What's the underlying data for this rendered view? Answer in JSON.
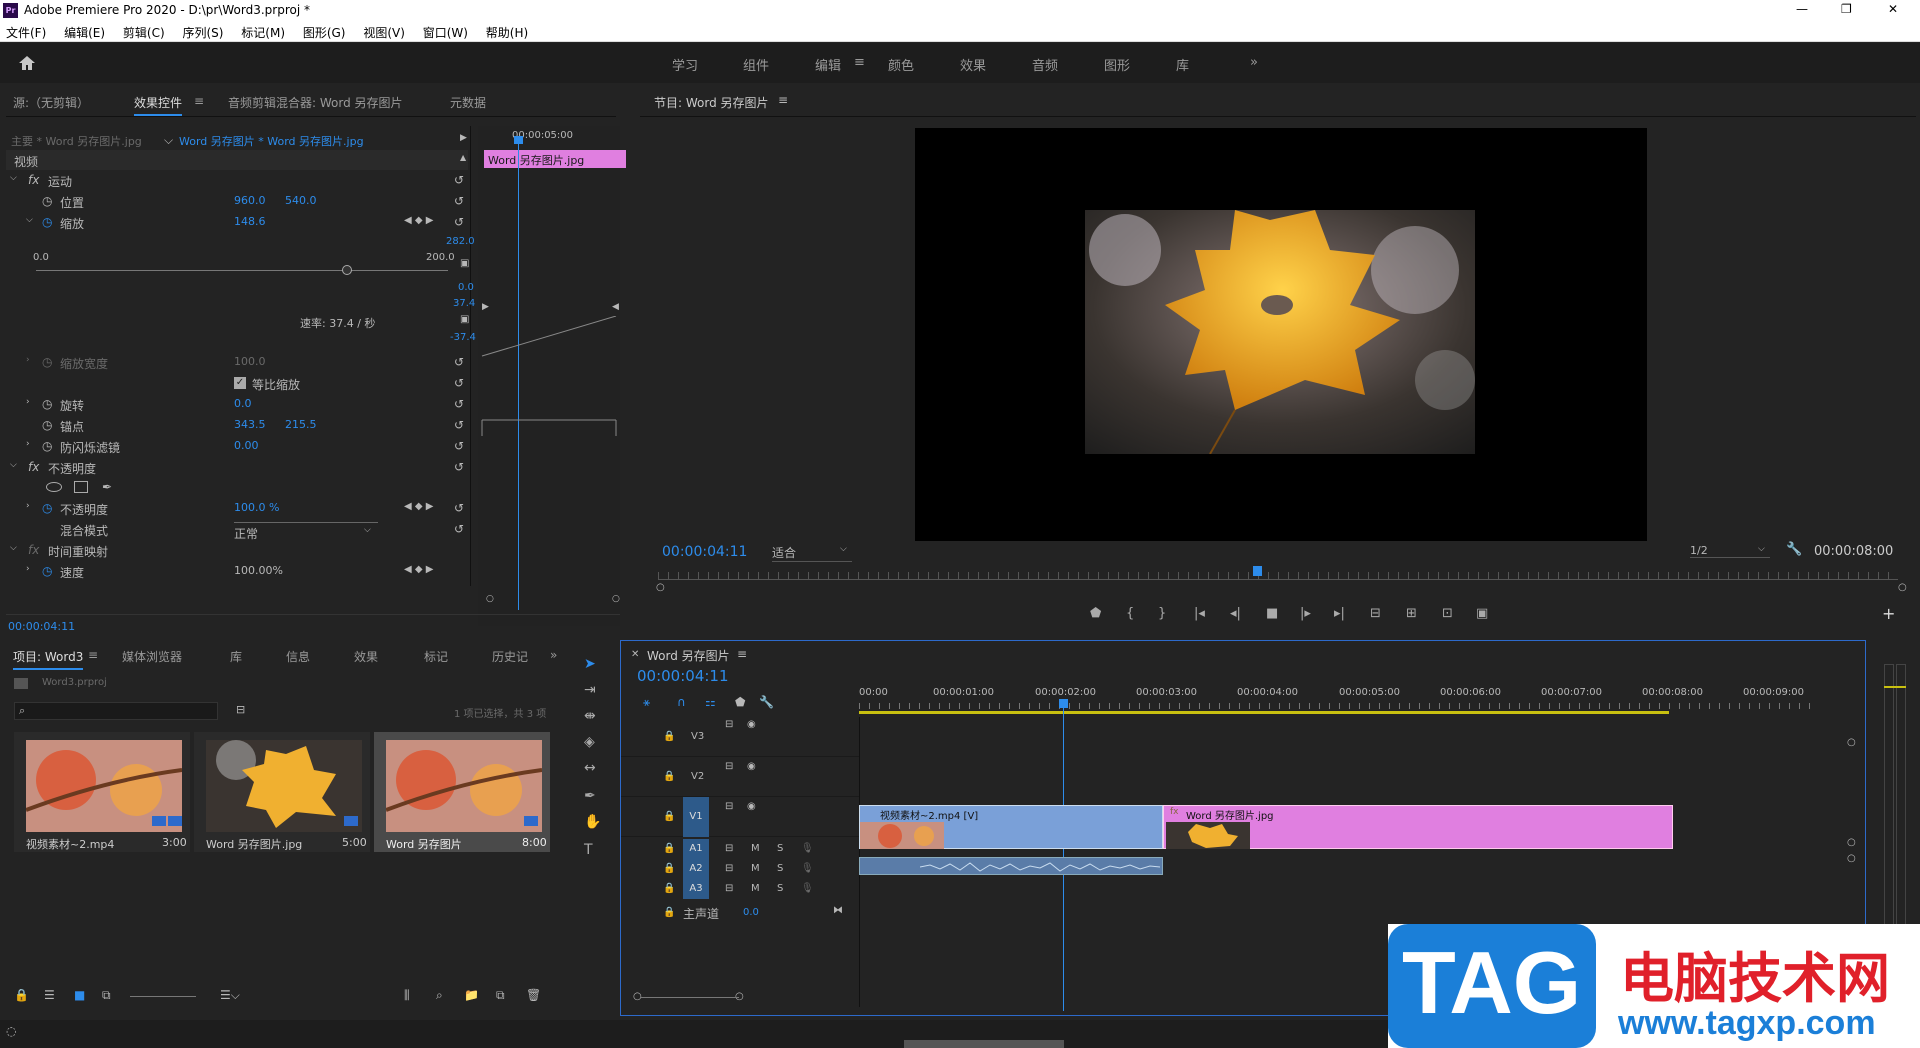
{
  "app": {
    "title": "Adobe Premiere Pro 2020 - D:\\pr\\Word3.prproj *",
    "icon": "Pr"
  },
  "window_controls": {
    "minimize": "—",
    "restore": "❐",
    "close": "✕"
  },
  "menu": [
    "文件(F)",
    "编辑(E)",
    "剪辑(C)",
    "序列(S)",
    "标记(M)",
    "图形(G)",
    "视图(V)",
    "窗口(W)",
    "帮助(H)"
  ],
  "workspaces": [
    "学习",
    "组件",
    "编辑",
    "颜色",
    "效果",
    "音频",
    "图形",
    "库"
  ],
  "workspace_active": "编辑",
  "source_panel": {
    "tabs": [
      "源:（无剪辑）",
      "效果控件",
      "音频剪辑混合器: Word 另存图片",
      "元数据"
    ],
    "active": "效果控件",
    "master": "主要 * Word 另存图片.jpg",
    "clip": "Word 另存图片 * Word 另存图片.jpg",
    "timecode_ruler": "00:00:05:00",
    "clip_bar": "Word 另存图片.jpg",
    "section_video": "视频",
    "motion": "运动",
    "position_label": "位置",
    "position_x": "960.0",
    "position_y": "540.0",
    "scale_label": "缩放",
    "scale_value": "148.6",
    "slider_min": "0.0",
    "slider_max": "200.0",
    "graph_top": "282.0",
    "graph_zero": "0.0",
    "vel_top": "37.4",
    "vel_label": "速率: 37.4 / 秒",
    "vel_bottom": "-37.4",
    "scale_width_label": "缩放宽度",
    "scale_width_value": "100.0",
    "uniform_scale": "等比缩放",
    "rotation_label": "旋转",
    "rotation_value": "0.0",
    "anchor_label": "锚点",
    "anchor_x": "343.5",
    "anchor_y": "215.5",
    "flicker_label": "防闪烁滤镜",
    "flicker_value": "0.00",
    "opacity_section": "不透明度",
    "opacity_label": "不透明度",
    "opacity_value": "100.0 %",
    "blend_label": "混合模式",
    "blend_value": "正常",
    "time_remap": "时间重映射",
    "speed_label": "速度",
    "speed_value": "100.00%",
    "bottom_timecode": "00:00:04:11"
  },
  "program_monitor": {
    "title": "节目: Word 另存图片",
    "timecode": "00:00:04:11",
    "fit": "适合",
    "resolution": "1/2",
    "duration": "00:00:08:00",
    "playhead_fraction": 0.47
  },
  "project_panel": {
    "tabs": [
      "项目: Word3",
      "媒体浏览器",
      "库",
      "信息",
      "效果",
      "标记",
      "历史记"
    ],
    "file": "Word3.prproj",
    "selection": "1 项已选择，共 3 项",
    "items": [
      {
        "name": "视频素材~2.mp4",
        "dur": "3:00"
      },
      {
        "name": "Word 另存图片.jpg",
        "dur": "5:00"
      },
      {
        "name": "Word 另存图片",
        "dur": "8:00"
      }
    ]
  },
  "timeline": {
    "title": "Word 另存图片",
    "timecode": "00:00:04:11",
    "ruler": [
      "00:00",
      "00:00:01:00",
      "00:00:02:00",
      "00:00:03:00",
      "00:00:04:00",
      "00:00:05:00",
      "00:00:06:00",
      "00:00:07:00",
      "00:00:08:00",
      "00:00:09:00"
    ],
    "tracks": [
      "V3",
      "V2",
      "V1",
      "A1",
      "A2",
      "A3"
    ],
    "master": "主声道",
    "master_value": "0.0",
    "clip1": "视频素材~2.mp4 [V]",
    "clip2": "Word 另存图片.jpg",
    "track_m": "M",
    "track_s": "S"
  },
  "watermark": {
    "tag": "TAG",
    "cn": "电脑技术网",
    "url": "www.tagxp.com"
  }
}
